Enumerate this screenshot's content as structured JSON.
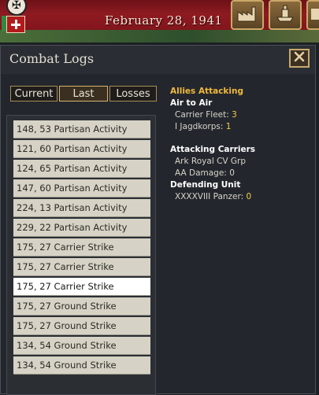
{
  "topbar": {
    "date": "February 28, 1941",
    "buttons": [
      {
        "icon": "factory-icon"
      },
      {
        "icon": "ship-icon"
      },
      {
        "icon": "building-icon"
      }
    ]
  },
  "panel": {
    "title": "Combat Logs",
    "close_icon": "close-icon",
    "tabs": [
      {
        "label": "Current",
        "active": false
      },
      {
        "label": "Last",
        "active": true
      },
      {
        "label": "Losses",
        "active": false
      }
    ],
    "logs": [
      {
        "label": "148, 53 Partisan Activity",
        "selected": false
      },
      {
        "label": "121, 60 Partisan Activity",
        "selected": false
      },
      {
        "label": "124, 65 Partisan Activity",
        "selected": false
      },
      {
        "label": "147, 60 Partisan Activity",
        "selected": false
      },
      {
        "label": "224, 13 Partisan Activity",
        "selected": false
      },
      {
        "label": "229, 22 Partisan Activity",
        "selected": false
      },
      {
        "label": "175, 27 Carrier Strike",
        "selected": false
      },
      {
        "label": "175, 27 Carrier Strike",
        "selected": false
      },
      {
        "label": "175, 27 Carrier Strike",
        "selected": true
      },
      {
        "label": "175, 27 Ground Strike",
        "selected": false
      },
      {
        "label": "175, 27 Ground Strike",
        "selected": false
      },
      {
        "label": "134, 54 Ground Strike",
        "selected": false
      },
      {
        "label": "134, 54 Ground Strike",
        "selected": false
      }
    ],
    "details": {
      "heading": "Allies Attacking",
      "air_to_air": {
        "title": "Air to Air",
        "carrier_fleet_label": "Carrier Fleet:",
        "carrier_fleet_value": "3",
        "jagdkorps_label": "I Jagdkorps:",
        "jagdkorps_value": "1"
      },
      "attacking_carriers": {
        "title": "Attacking Carriers",
        "group": "Ark Royal CV Grp",
        "aa_damage_label": "AA Damage:",
        "aa_damage_value": "0"
      },
      "defending_unit": {
        "title": "Defending Unit",
        "unit_label": "XXXXVIII Panzer:",
        "unit_value": "0"
      }
    }
  }
}
